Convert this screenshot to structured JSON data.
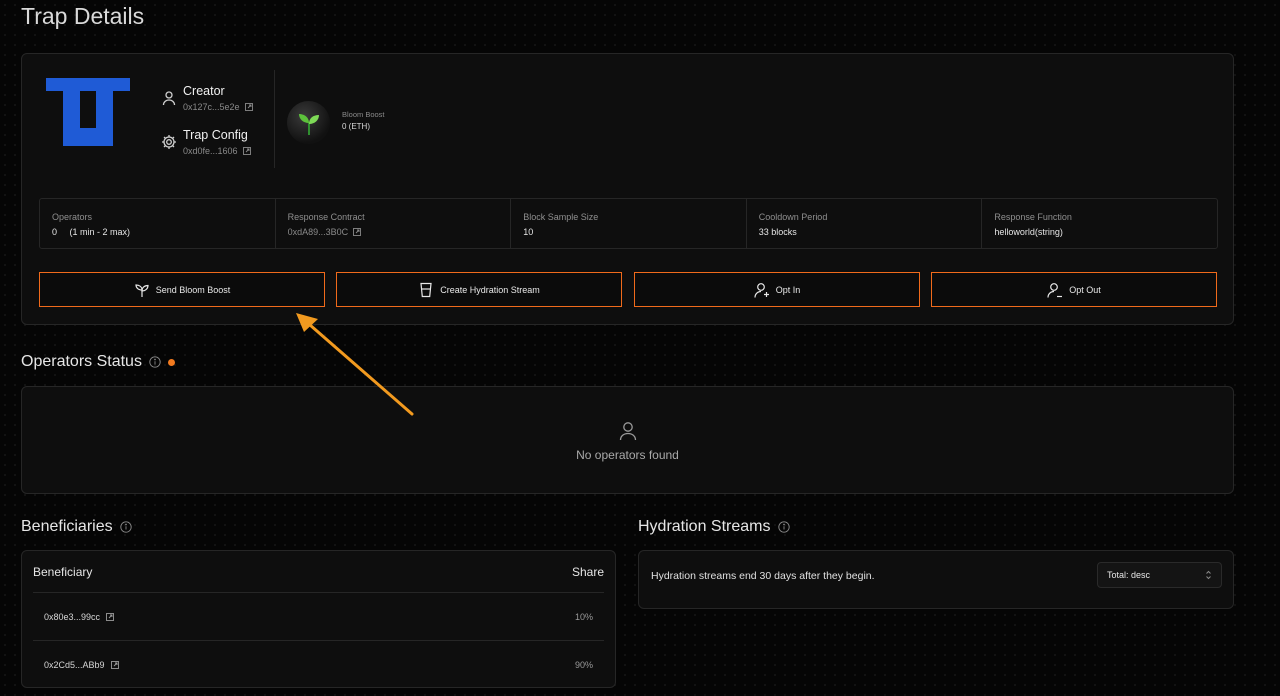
{
  "page": {
    "title": "Trap Details"
  },
  "creator": {
    "title": "Creator",
    "address": "0x127c...5e2e",
    "icon": "user-icon"
  },
  "trap_config": {
    "title": "Trap Config",
    "address": "0xd0fe...1606",
    "icon": "gear-icon"
  },
  "bloom": {
    "label": "Bloom Boost",
    "value": "0 (ETH)",
    "icon": "sprout-icon"
  },
  "stats": [
    {
      "label": "Operators",
      "value": "0     (1 min - 2 max)"
    },
    {
      "label": "Response Contract",
      "value": "0xdA89...3B0C"
    },
    {
      "label": "Block Sample Size",
      "value": "10"
    },
    {
      "label": "Cooldown Period",
      "value": "33 blocks"
    },
    {
      "label": "Response Function",
      "value": "helloworld(string)"
    }
  ],
  "actions": {
    "send_bloom_boost": "Send Bloom Boost",
    "create_hydration_stream": "Create Hydration Stream",
    "opt_in": "Opt In",
    "opt_out": "Opt Out"
  },
  "operators_status": {
    "title": "Operators Status",
    "empty": "No operators found"
  },
  "beneficiaries": {
    "title": "Beneficiaries",
    "columns": {
      "beneficiary": "Beneficiary",
      "share": "Share"
    },
    "rows": [
      {
        "address": "0x80e3...99cc",
        "share": "10%"
      },
      {
        "address": "0x2Cd5...ABb9",
        "share": "90%"
      }
    ]
  },
  "hydration_streams": {
    "title": "Hydration Streams",
    "text": "Hydration streams end 30 days after they begin.",
    "sort_selected": "Total: desc"
  },
  "colors": {
    "accent": "#f06a1b",
    "logo_blue": "#1f5bd6",
    "background": "#050505"
  }
}
